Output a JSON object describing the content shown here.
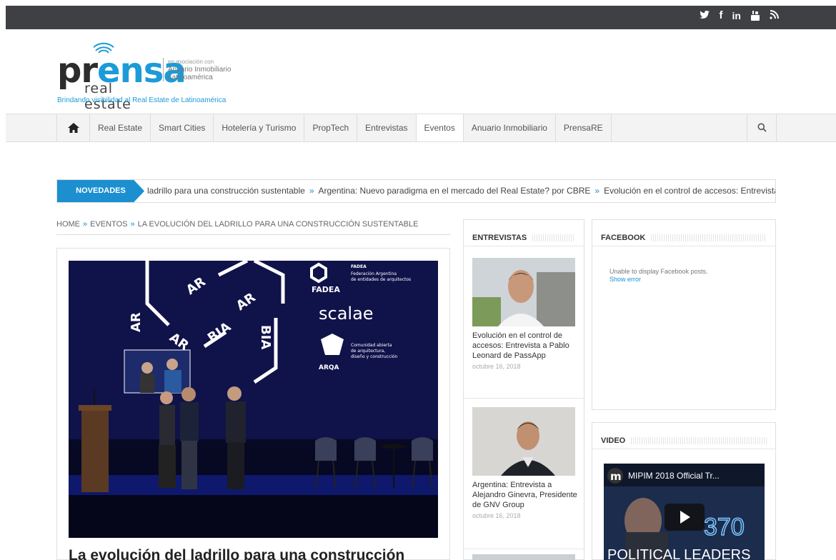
{
  "social": {
    "icons": [
      "twitter-icon",
      "facebook-icon",
      "linkedin-icon",
      "youtube-icon",
      "rss-icon"
    ],
    "glyphs": [
      "𝕪",
      "f",
      "in",
      "▣",
      "ℵ"
    ]
  },
  "logo": {
    "word": "prensa",
    "sub": "real estate",
    "assoc_small": "en asociación con",
    "assoc_main": "Anuario Inmobiliario Latinoamérica",
    "tagline": "Brindando visibilidad al Real Estate de Latinoamérica"
  },
  "nav": {
    "items": [
      "Real Estate",
      "Smart Cities",
      "Hotelería y Turismo",
      "PropTech",
      "Entrevistas",
      "Eventos",
      "Anuario Inmobiliario",
      "PrensaRE"
    ],
    "active": "Eventos"
  },
  "ticker": {
    "label": "NOVEDADES",
    "items": [
      "ladrillo para una construcción sustentable",
      "Argentina: Nuevo paradigma en el mercado del Real Estate? por CBRE",
      "Evolución en el control de accesos: Entrevista"
    ]
  },
  "breadcrumb": {
    "items": [
      "HOME",
      "EVENTOS",
      "LA EVOLUCIÓN DEL LADRILLO PARA UNA CONSTRUCCIÓN SUSTENTABLE"
    ]
  },
  "article": {
    "title": "La evolución del ladrillo para una construcción",
    "slide": {
      "fadea": "FADEA",
      "fadea_desc": "Federación Argentina de entidades de arquitectos",
      "scalae": "scalae",
      "arqa": "ARQA",
      "arqa_desc": "Comunidad abierta de arquitectura, diseño y construcción"
    }
  },
  "entrevistas": {
    "title": "ENTREVISTAS",
    "posts": [
      {
        "title": "Evolución en el control de accesos: Entrevista a Pablo Leonard de PassApp",
        "date": "octubre 16, 2018"
      },
      {
        "title": "Argentina: Entrevista a Alejandro Ginevra, Presidente de GNV Group",
        "date": "octubre 16, 2018"
      }
    ]
  },
  "facebook": {
    "title": "FACEBOOK",
    "message": "Unable to display Facebook posts.",
    "link": "Show error"
  },
  "video": {
    "title": "VIDEO",
    "video_title": "MIPIM 2018 Official Tr...",
    "number": "370",
    "caption": "POLITICAL LEADERS"
  }
}
